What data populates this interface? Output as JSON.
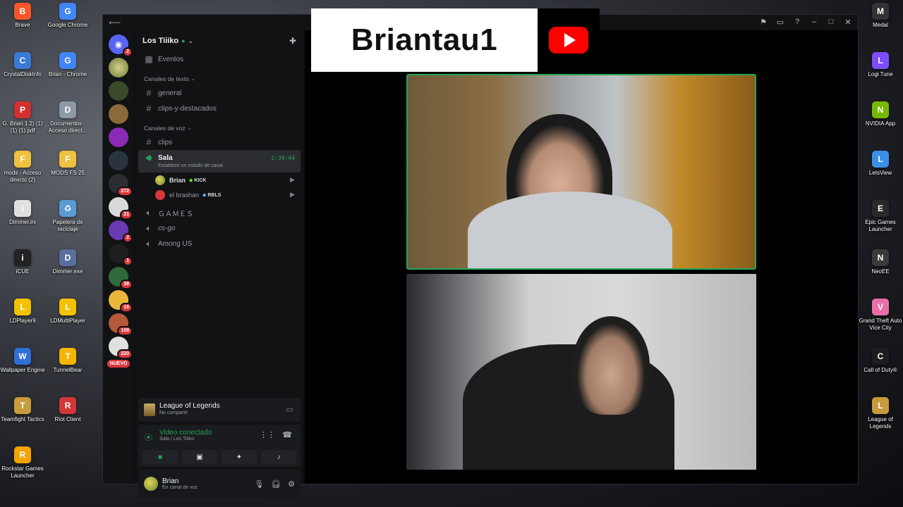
{
  "desktop_left": [
    {
      "label": "Brave",
      "color": "#fb542b",
      "glyph": "B"
    },
    {
      "label": "Google Chrome",
      "color": "#4285f4",
      "glyph": "G"
    },
    {
      "label": "CrystalDiskInfo",
      "color": "#3a7bd5",
      "glyph": "C"
    },
    {
      "label": "Brian - Chrome",
      "color": "#4285f4",
      "glyph": "G"
    },
    {
      "label": "G. Brian 1 2) (1) (1) (1).pdf",
      "color": "#d32f2f",
      "glyph": "P"
    },
    {
      "label": "Documentos - Acceso direct...",
      "color": "#8e9aa6",
      "glyph": "D"
    },
    {
      "label": "mods - Acceso directo (2)",
      "color": "#f0c040",
      "glyph": "F"
    },
    {
      "label": "MODS FS 25",
      "color": "#f0c040",
      "glyph": "F"
    },
    {
      "label": "Dimmer.ini",
      "color": "#e0e0e0",
      "glyph": "i"
    },
    {
      "label": "Papelera de reciclaje",
      "color": "#5a9bd4",
      "glyph": "♻"
    },
    {
      "label": "iCUE",
      "color": "#222",
      "glyph": "i"
    },
    {
      "label": "Dimmer.exe",
      "color": "#5a6ea0",
      "glyph": "D"
    },
    {
      "label": "LDPlayer9",
      "color": "#f2c200",
      "glyph": "L"
    },
    {
      "label": "LDMultiPlayer",
      "color": "#f2c200",
      "glyph": "L"
    },
    {
      "label": "Wallpaper Engine",
      "color": "#2f6fd6",
      "glyph": "W"
    },
    {
      "label": "TunnelBear",
      "color": "#f5b400",
      "glyph": "T"
    },
    {
      "label": "Teamfight Tactics",
      "color": "#c89b3c",
      "glyph": "T"
    },
    {
      "label": "Riot Client",
      "color": "#d13639",
      "glyph": "R"
    },
    {
      "label": "Rockstar Games Launcher",
      "color": "#f4a300",
      "glyph": "R"
    }
  ],
  "desktop_right": [
    {
      "label": "Medal",
      "color": "#333",
      "glyph": "M"
    },
    {
      "label": "Logi Tune",
      "color": "#7c4dff",
      "glyph": "L"
    },
    {
      "label": "NVIDIA App",
      "color": "#76b900",
      "glyph": "N"
    },
    {
      "label": "LetsView",
      "color": "#3b8fe6",
      "glyph": "L"
    },
    {
      "label": "Epic Games Launcher",
      "color": "#2a2a2a",
      "glyph": "E"
    },
    {
      "label": "NeoEE",
      "color": "#3a3a3a",
      "glyph": "N"
    },
    {
      "label": "Grand Theft Auto Vice City",
      "color": "#e86fa8",
      "glyph": "V"
    },
    {
      "label": "Call of Duty®",
      "color": "#1e1e1e",
      "glyph": "C"
    },
    {
      "label": "League of Legends",
      "color": "#c89b3c",
      "glyph": "L"
    }
  ],
  "server": {
    "name": "Los Tiiiko"
  },
  "channels": {
    "events": "Eventos",
    "text_category": "Canales de texto",
    "text": [
      "general",
      "clips-y-destacados"
    ],
    "voice_category": "Canales de voz",
    "clips": "clips",
    "sala": {
      "name": "Sala",
      "time": "2:39:44",
      "status": "Establece un estado de canal"
    },
    "voice_users": [
      {
        "name": "Brian",
        "tag": "KICK",
        "tag_color": "#53fc18"
      },
      {
        "name": "el brashan",
        "tag": "RBLS",
        "tag_color": "#5bc0eb"
      }
    ],
    "other_voice": [
      "ＧＡＭＥＳ",
      "cs-go",
      "Among US"
    ]
  },
  "server_badges": [
    "2",
    "272",
    "21",
    "2",
    "1",
    "38",
    "18",
    "109",
    "220"
  ],
  "new_label": "NUEVO",
  "activity": {
    "title": "League of Legends",
    "sub": "No compartir"
  },
  "rtc": {
    "status": "Video conectado",
    "sub": "Sala / Los Tiiiko"
  },
  "user": {
    "name": "Brian",
    "status": "En canal de voz"
  },
  "overlay": {
    "name": "Briantau1"
  },
  "colors": {
    "accent_green": "#23a55a",
    "badge_red": "#da373c",
    "yt_red": "#ff0000"
  }
}
